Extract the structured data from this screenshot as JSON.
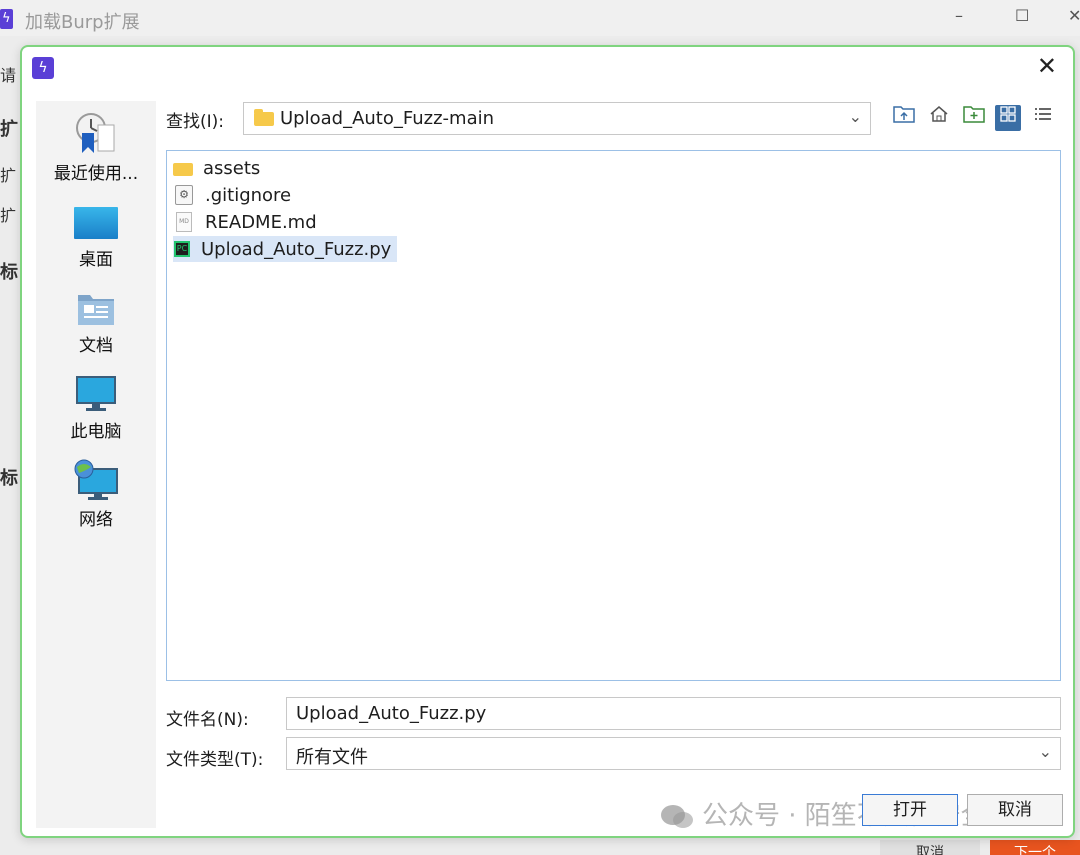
{
  "background_window": {
    "title": "加载Burp扩展",
    "minimize_glyph": "–",
    "maximize_glyph": "☐",
    "close_glyph": "✕",
    "side_fragments": [
      "请",
      "扩",
      "扩",
      "扩",
      "标",
      "标"
    ],
    "bottom_left_button": "取消",
    "bottom_right_button": "下一个"
  },
  "dialog": {
    "close_glyph": "✕",
    "places": [
      {
        "label": "最近使用...",
        "icon": "recent-icon"
      },
      {
        "label": "桌面",
        "icon": "desktop-icon"
      },
      {
        "label": "文档",
        "icon": "documents-icon"
      },
      {
        "label": "此电脑",
        "icon": "computer-icon"
      },
      {
        "label": "网络",
        "icon": "network-icon"
      }
    ],
    "look_in": {
      "label": "查找(I):",
      "value": "Upload_Auto_Fuzz-main"
    },
    "toolbar": [
      "up-folder-icon",
      "home-icon",
      "new-folder-icon",
      "list-view-icon",
      "details-view-icon"
    ],
    "files": [
      {
        "name": "assets",
        "type": "folder"
      },
      {
        "name": ".gitignore",
        "type": "file"
      },
      {
        "name": "README.md",
        "type": "markdown"
      },
      {
        "name": "Upload_Auto_Fuzz.py",
        "type": "python",
        "selected": true
      }
    ],
    "file_name": {
      "label": "文件名(N):",
      "value": "Upload_Auto_Fuzz.py"
    },
    "file_type": {
      "label": "文件类型(T):",
      "value": "所有文件"
    },
    "open_button": "打开",
    "cancel_button": "取消"
  },
  "watermark": "公众号 · 陌笙不太懂安全",
  "colors": {
    "accent": "#3a6ea5",
    "dialog_border": "#7fd47f",
    "selection": "#d9e6f7",
    "folder": "#f6c94a",
    "app_icon": "#5a3fd6"
  }
}
